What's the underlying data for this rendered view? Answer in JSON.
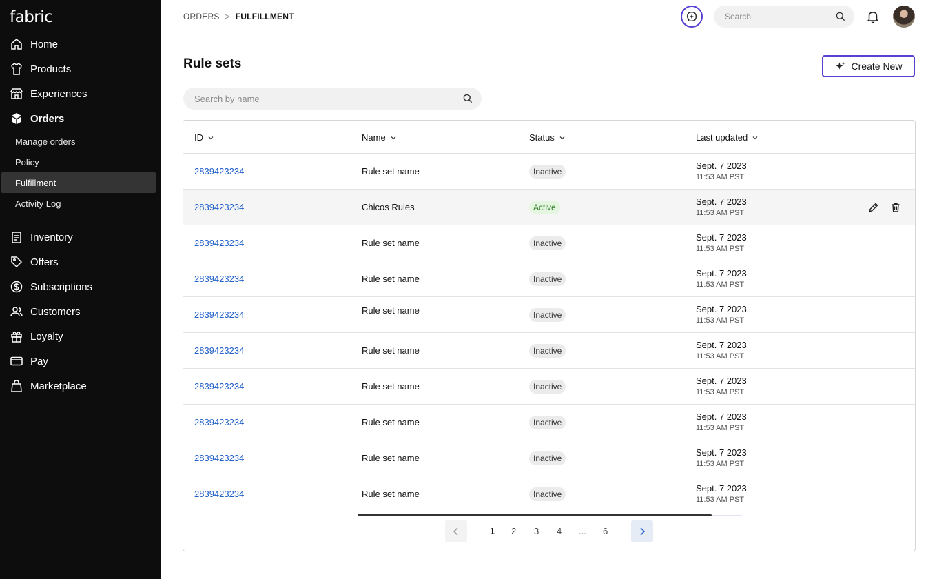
{
  "sidebar": {
    "logo": "fabric",
    "items": [
      {
        "label": "Home",
        "icon": "home-icon"
      },
      {
        "label": "Products",
        "icon": "shirt-icon"
      },
      {
        "label": "Experiences",
        "icon": "storefront-icon"
      },
      {
        "label": "Orders",
        "icon": "box-icon"
      }
    ],
    "sub_items": [
      {
        "label": "Manage orders"
      },
      {
        "label": "Policy"
      },
      {
        "label": "Fulfillment",
        "active": true
      },
      {
        "label": "Activity Log"
      }
    ],
    "items2": [
      {
        "label": "Inventory",
        "icon": "clipboard-icon"
      },
      {
        "label": "Offers",
        "icon": "tag-icon"
      },
      {
        "label": "Subscriptions",
        "icon": "dollar-circle-icon"
      },
      {
        "label": "Customers",
        "icon": "users-icon"
      },
      {
        "label": "Loyalty",
        "icon": "gift-icon"
      },
      {
        "label": "Pay",
        "icon": "credit-card-icon"
      },
      {
        "label": "Marketplace",
        "icon": "bag-icon"
      }
    ]
  },
  "topbar": {
    "breadcrumb": [
      "ORDERS",
      "FULFILLMENT"
    ],
    "search_placeholder": "Search"
  },
  "main": {
    "title": "Rule sets",
    "create_label": "Create New",
    "search_placeholder": "Search by name"
  },
  "table": {
    "columns": [
      "ID",
      "Name",
      "Status",
      "Last updated"
    ],
    "rows": [
      {
        "id": "2839423234",
        "name": "Rule set name",
        "status": "Inactive",
        "date": "Sept. 7 2023",
        "time": "11:53 AM PST"
      },
      {
        "id": "2839423234",
        "name": "Chicos Rules",
        "status": "Active",
        "date": "Sept. 7 2023",
        "time": "11:53 AM PST"
      },
      {
        "id": "2839423234",
        "name": "Rule set name",
        "status": "Inactive",
        "date": "Sept. 7 2023",
        "time": "11:53 AM PST"
      },
      {
        "id": "2839423234",
        "name": "Rule set name",
        "status": "Inactive",
        "date": "Sept. 7 2023",
        "time": "11:53 AM PST"
      },
      {
        "id": "2839423234",
        "name": "Rule set name",
        "status": "Inactive",
        "date": "Sept. 7 2023",
        "time": "11:53 AM PST"
      },
      {
        "id": "2839423234",
        "name": "Rule set name",
        "status": "Inactive",
        "date": "Sept. 7 2023",
        "time": "11:53 AM PST"
      },
      {
        "id": "2839423234",
        "name": "Rule set name",
        "status": "Inactive",
        "date": "Sept. 7 2023",
        "time": "11:53 AM PST"
      },
      {
        "id": "2839423234",
        "name": "Rule set name",
        "status": "Inactive",
        "date": "Sept. 7 2023",
        "time": "11:53 AM PST"
      },
      {
        "id": "2839423234",
        "name": "Rule set name",
        "status": "Inactive",
        "date": "Sept. 7 2023",
        "time": "11:53 AM PST"
      },
      {
        "id": "2839423234",
        "name": "Rule set name",
        "status": "Inactive",
        "date": "Sept. 7 2023",
        "time": "11:53 AM PST"
      }
    ]
  },
  "pagination": {
    "pages": [
      "1",
      "2",
      "3",
      "4",
      "...",
      "6"
    ],
    "current": "1"
  },
  "colors": {
    "accent": "#5a3fd1",
    "link": "#1f5fc9",
    "sidebar_bg": "#0d0d0d"
  }
}
